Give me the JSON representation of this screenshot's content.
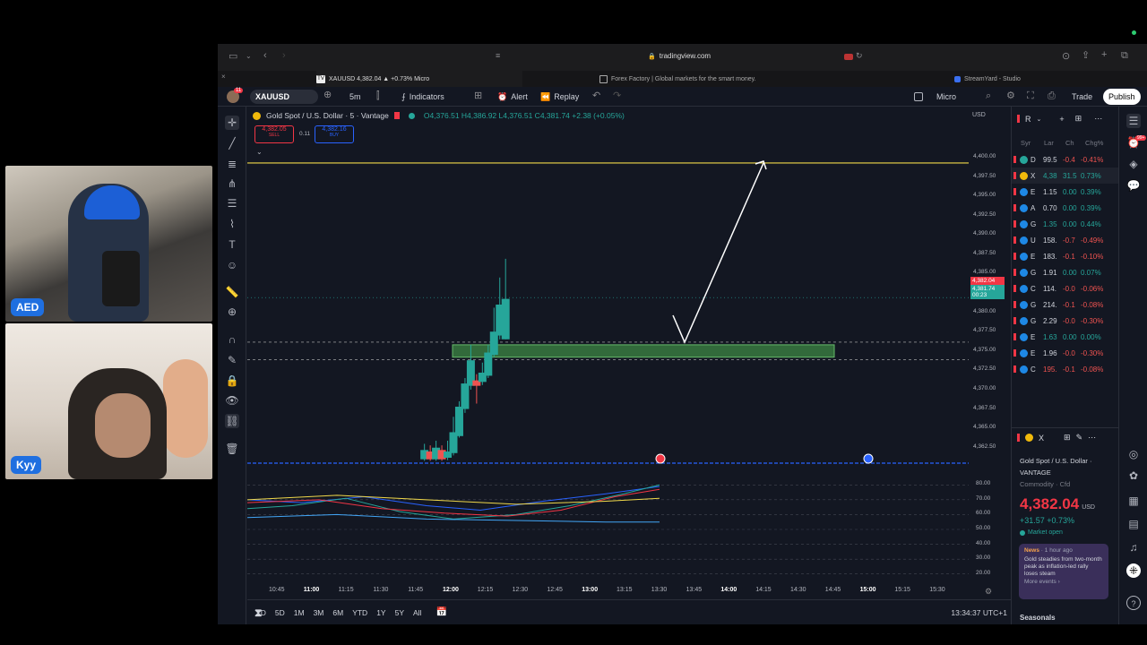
{
  "cams": {
    "top_tag": "AED",
    "bottom_tag": "Kyy"
  },
  "browser": {
    "url": "tradingview.com",
    "tabs": [
      {
        "label": "XAUUSD 4,382.04 ▲ +0.73% Micro"
      },
      {
        "label": "Forex Factory | Global markets for the smart money."
      },
      {
        "label": "StreamYard - Studio"
      }
    ]
  },
  "toolbar": {
    "notif_count": "11",
    "symbol": "XAUUSD",
    "interval": "5m",
    "indicators": "Indicators",
    "alert": "Alert",
    "replay": "Replay",
    "micro": "Micro",
    "trade": "Trade",
    "publish": "Publish"
  },
  "legend": {
    "title": "Gold Spot / U.S. Dollar · 5 · Vantage",
    "ohlc": "O4,376.51 H4,386.92 L4,376.51 C4,381.74 +2.38 (+0.05%)",
    "sell_price": "4,382.05",
    "sell_label": "SELL",
    "spread": "0.11",
    "buy_price": "4,382.16",
    "buy_label": "BUY",
    "currency": "USD"
  },
  "chart_data": {
    "type": "candlestick",
    "title": "Gold Spot / U.S. Dollar · 5 · Vantage",
    "y_ticks": [
      "4,400.00",
      "4,397.50",
      "4,395.00",
      "4,392.50",
      "4,390.00",
      "4,387.50",
      "4,385.00",
      "4,382.50",
      "4,380.00",
      "4,377.50",
      "4,375.00",
      "4,372.50",
      "4,370.00",
      "4,367.50",
      "4,365.00",
      "4,362.50"
    ],
    "ylim": [
      4360.5,
      4401.5
    ],
    "x_ticks": [
      "10:45",
      "11:00",
      "11:15",
      "11:30",
      "11:45",
      "12:00",
      "12:15",
      "12:30",
      "12:45",
      "13:00",
      "13:15",
      "13:30",
      "13:45",
      "14:00",
      "14:15",
      "14:30",
      "14:45",
      "15:00",
      "15:15",
      "15:30"
    ],
    "candles": [
      {
        "t": 58.5,
        "o": 4361.0,
        "c": 4362.2,
        "h": 4363.0,
        "l": 4360.8
      },
      {
        "t": 59.0,
        "o": 4362.0,
        "c": 4361.0,
        "h": 4362.8,
        "l": 4360.8
      },
      {
        "t": 59.5,
        "o": 4361.0,
        "c": 4362.5,
        "h": 4363.4,
        "l": 4360.8
      },
      {
        "t": 60.0,
        "o": 4362.2,
        "c": 4361.0,
        "h": 4362.8,
        "l": 4360.8
      },
      {
        "t": 60.5,
        "o": 4361.2,
        "c": 4362.0,
        "h": 4363.4,
        "l": 4360.9
      },
      {
        "t": 61.0,
        "o": 4361.8,
        "c": 4364.5,
        "h": 4366.5,
        "l": 4361.5
      },
      {
        "t": 61.5,
        "o": 4364.0,
        "c": 4367.8,
        "h": 4368.5,
        "l": 4363.8
      },
      {
        "t": 62.0,
        "o": 4367.5,
        "c": 4370.8,
        "h": 4371.5,
        "l": 4367.0
      },
      {
        "t": 62.5,
        "o": 4370.5,
        "c": 4373.8,
        "h": 4375.8,
        "l": 4370.0
      },
      {
        "t": 63.0,
        "o": 4371.2,
        "c": 4370.5,
        "h": 4372.0,
        "l": 4368.2
      },
      {
        "t": 63.5,
        "o": 4371.0,
        "c": 4372.2,
        "h": 4373.5,
        "l": 4370.6
      },
      {
        "t": 64.0,
        "o": 4371.8,
        "c": 4374.8,
        "h": 4375.8,
        "l": 4371.5
      },
      {
        "t": 64.5,
        "o": 4374.5,
        "c": 4377.5,
        "h": 4380.6,
        "l": 4374.2
      },
      {
        "t": 65.0,
        "o": 4377.0,
        "c": 4381.0,
        "h": 4384.5,
        "l": 4376.5
      },
      {
        "t": 65.5,
        "o": 4376.51,
        "c": 4381.74,
        "h": 4386.92,
        "l": 4376.51
      }
    ],
    "lines": [
      {
        "name": "",
        "value": 4400.0
      }
    ],
    "zone": {
      "from": 4374.2,
      "to": 4375.8
    },
    "oscillator_ticks": [
      "80.00",
      "70.00",
      "60.00",
      "50.00",
      "40.00",
      "30.00",
      "20.00"
    ]
  },
  "price_labels": {
    "last": "4,382.04",
    "bid": "4,381.74",
    "countdown": "00:23"
  },
  "timeframes": [
    "1D",
    "5D",
    "1M",
    "3M",
    "6M",
    "YTD",
    "1Y",
    "5Y",
    "All"
  ],
  "clock": "13:34:37 UTC+1",
  "watchlist": {
    "title": "R",
    "headers": [
      "Syr",
      "Lar",
      "Ch",
      "Chg%"
    ],
    "rows": [
      {
        "sym": "D",
        "last": "99.5",
        "chg": "-0.4",
        "pct": "-0.41%",
        "dir": "down",
        "color": "#26a69a"
      },
      {
        "sym": "X",
        "last": "4,38",
        "chg": "31.5",
        "pct": "0.73%",
        "dir": "up",
        "color": "#f0b90b"
      },
      {
        "sym": "E",
        "last": "1.15",
        "chg": "0.00",
        "pct": "0.39%",
        "dir": "up",
        "color": "#1e88e5"
      },
      {
        "sym": "A",
        "last": "0.70",
        "chg": "0.00",
        "pct": "0.39%",
        "dir": "up",
        "color": "#1e88e5"
      },
      {
        "sym": "G",
        "last": "1.35",
        "chg": "0.00",
        "pct": "0.44%",
        "dir": "up",
        "color": "#1e88e5"
      },
      {
        "sym": "U",
        "last": "158.",
        "chg": "-0.7",
        "pct": "-0.49%",
        "dir": "down",
        "color": "#1e88e5"
      },
      {
        "sym": "E",
        "last": "183.",
        "chg": "-0.1",
        "pct": "-0.10%",
        "dir": "down",
        "color": "#1e88e5"
      },
      {
        "sym": "G",
        "last": "1.91",
        "chg": "0.00",
        "pct": "0.07%",
        "dir": "up",
        "color": "#1e88e5"
      },
      {
        "sym": "C",
        "last": "114.",
        "chg": "-0.0",
        "pct": "-0.06%",
        "dir": "down",
        "color": "#1e88e5"
      },
      {
        "sym": "G",
        "last": "214.",
        "chg": "-0.1",
        "pct": "-0.08%",
        "dir": "down",
        "color": "#1e88e5"
      },
      {
        "sym": "G",
        "last": "2.29",
        "chg": "-0.0",
        "pct": "-0.30%",
        "dir": "down",
        "color": "#1e88e5"
      },
      {
        "sym": "E",
        "last": "1.63",
        "chg": "0.00",
        "pct": "0.00%",
        "dir": "up",
        "color": "#1e88e5"
      },
      {
        "sym": "E",
        "last": "1.96",
        "chg": "-0.0",
        "pct": "-0.30%",
        "dir": "down",
        "color": "#1e88e5"
      },
      {
        "sym": "C",
        "last": "195.",
        "chg": "-0.1",
        "pct": "-0.08%",
        "dir": "down",
        "color": "#1e88e5"
      }
    ]
  },
  "details": {
    "symbol": "X",
    "name": "Gold Spot / U.S. Dollar",
    "exchange": "VANTAGE",
    "category": "Commodity · Cfd",
    "price": "4,382.04",
    "currency": "USD",
    "change": "+31.57 +0.73%",
    "status": "Market open",
    "news_label": "News",
    "news_time": "· 1 hour ago",
    "news_text": "Gold steadies from two-month peak as inflation-led rally loses steam",
    "more_events": "More events ›",
    "seasonals": "Seasonals",
    "notif_badge": "99+"
  },
  "colors": {
    "up": "#26a69a",
    "down": "#ef5350",
    "accent": "#2962ff",
    "yellow": "#f0d84a"
  }
}
